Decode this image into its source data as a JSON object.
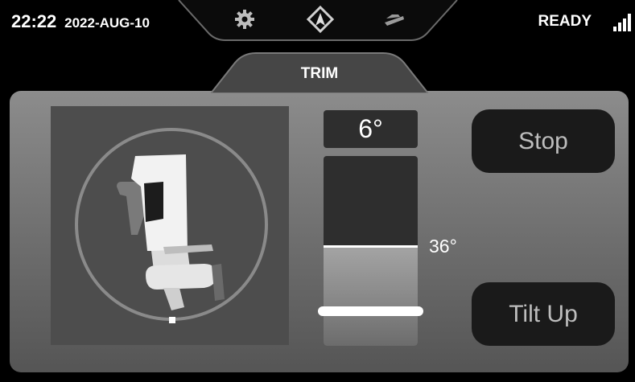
{
  "status_bar": {
    "time": "22:22",
    "date": "2022-AUG-10",
    "status": "READY",
    "signal_icon": "signal-bars-icon"
  },
  "nav": {
    "items": [
      {
        "icon": "gear-icon"
      },
      {
        "icon": "navigation-arrow-icon"
      },
      {
        "icon": "boat-icon"
      }
    ]
  },
  "tab": {
    "label": "TRIM"
  },
  "trim": {
    "angle": "6°",
    "angle_value_deg": 6,
    "limit": "36°",
    "limit_value_deg": 36,
    "illustration_icon": "outboard-motor-icon"
  },
  "buttons": {
    "stop_label": "Stop",
    "tilt_up_label": "Tilt Up"
  },
  "colors": {
    "background": "#000000",
    "panel_top": "#8c8c8c",
    "button_bg": "#1a1a1a",
    "button_text": "#bdbdbd"
  }
}
